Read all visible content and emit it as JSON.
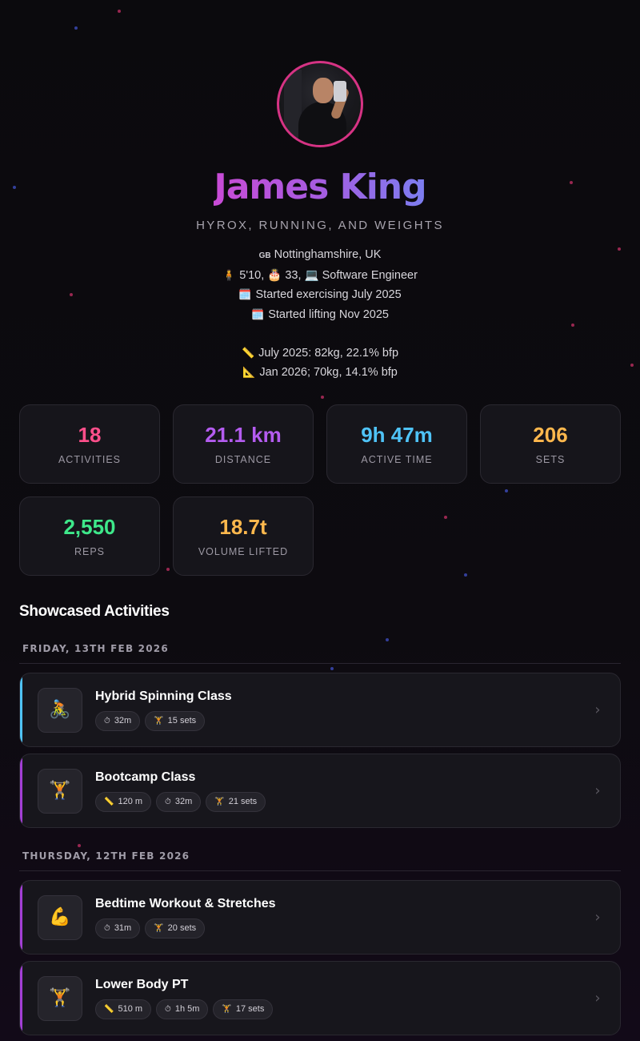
{
  "profile": {
    "name": "James King",
    "tagline": "HYROX, RUNNING, AND WEIGHTS",
    "location_flag": "GB",
    "location": "Nottinghamshire, UK",
    "details": "5'10, 🎂 33, 💻 Software Engineer",
    "started_exercising": "Started exercising July 2025",
    "started_lifting": "Started lifting Nov 2025",
    "measure_1": "July 2025: 82kg, 22.1% bfp",
    "measure_2": "Jan 2026; 70kg, 14.1% bfp",
    "avatar_border_color": "#d63384"
  },
  "stats": [
    {
      "value": "18",
      "label": "ACTIVITIES",
      "color": "#ff4f8b"
    },
    {
      "value": "21.1 km",
      "label": "DISTANCE",
      "color": "#b45cf0"
    },
    {
      "value": "9h 47m",
      "label": "ACTIVE TIME",
      "color": "#4fc3f7"
    },
    {
      "value": "206",
      "label": "SETS",
      "color": "#ffb84d"
    },
    {
      "value": "2,550",
      "label": "REPS",
      "color": "#3ee88a"
    },
    {
      "value": "18.7t",
      "label": "VOLUME LIFTED",
      "color": "#ffb84d"
    }
  ],
  "showcase": {
    "title": "Showcased Activities",
    "groups": [
      {
        "date": "FRIDAY, 13TH FEB 2026",
        "activities": [
          {
            "title": "Hybrid Spinning Class",
            "icon": "cyclist-icon",
            "accent": "#4fc3f7",
            "chips": [
              {
                "icon": "stopwatch-icon",
                "text": "32m"
              },
              {
                "icon": "weightlifter-icon",
                "text": "15 sets"
              }
            ]
          },
          {
            "title": "Bootcamp Class",
            "icon": "weightlifter-icon",
            "accent": "#a33fd6",
            "chips": [
              {
                "icon": "ruler-icon",
                "text": "120 m"
              },
              {
                "icon": "stopwatch-icon",
                "text": "32m"
              },
              {
                "icon": "weightlifter-icon",
                "text": "21 sets"
              }
            ]
          }
        ]
      },
      {
        "date": "THURSDAY, 12TH FEB 2026",
        "activities": [
          {
            "title": "Bedtime Workout & Stretches",
            "icon": "flexed-bicep-icon",
            "accent": "#a33fd6",
            "chips": [
              {
                "icon": "stopwatch-icon",
                "text": "31m"
              },
              {
                "icon": "weightlifter-icon",
                "text": "20 sets"
              }
            ]
          },
          {
            "title": "Lower Body PT",
            "icon": "weightlifter-icon",
            "accent": "#a33fd6",
            "chips": [
              {
                "icon": "ruler-icon",
                "text": "510 m"
              },
              {
                "icon": "stopwatch-icon",
                "text": "1h 5m"
              },
              {
                "icon": "weightlifter-icon",
                "text": "17 sets"
              }
            ]
          }
        ]
      }
    ]
  }
}
